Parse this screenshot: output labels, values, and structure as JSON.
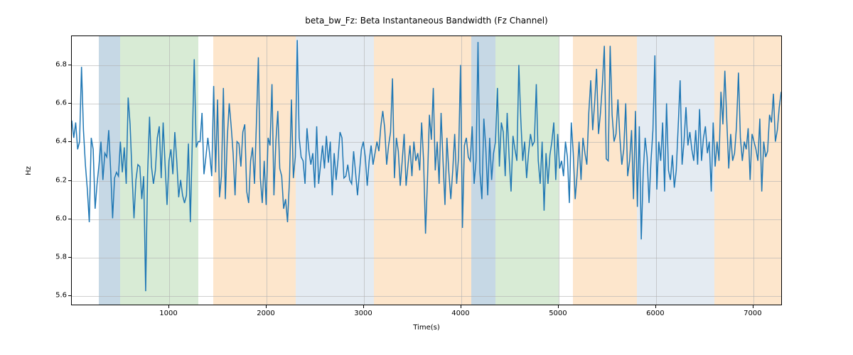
{
  "chart_data": {
    "type": "line",
    "title": "beta_bw_Fz: Beta Instantaneous Bandwidth (Fz Channel)",
    "xlabel": "Time(s)",
    "ylabel": "Hz",
    "xlim": [
      0,
      7300
    ],
    "ylim": [
      5.55,
      6.95
    ],
    "xticks": [
      1000,
      2000,
      3000,
      4000,
      5000,
      6000,
      7000
    ],
    "yticks": [
      5.6,
      5.8,
      6.0,
      6.2,
      6.4,
      6.6,
      6.8
    ],
    "spans": [
      {
        "x0": 280,
        "x1": 500,
        "color": "blue"
      },
      {
        "x0": 500,
        "x1": 1300,
        "color": "green"
      },
      {
        "x0": 1450,
        "x1": 2300,
        "color": "orange"
      },
      {
        "x0": 2300,
        "x1": 3100,
        "color": "lblue"
      },
      {
        "x0": 3100,
        "x1": 3200,
        "color": "orange"
      },
      {
        "x0": 3200,
        "x1": 4100,
        "color": "orange"
      },
      {
        "x0": 4100,
        "x1": 4350,
        "color": "blue"
      },
      {
        "x0": 4350,
        "x1": 5000,
        "color": "green"
      },
      {
        "x0": 5150,
        "x1": 5800,
        "color": "orange"
      },
      {
        "x0": 5800,
        "x1": 6600,
        "color": "lblue"
      },
      {
        "x0": 6600,
        "x1": 7300,
        "color": "orange"
      }
    ],
    "x": [
      0,
      20,
      40,
      60,
      80,
      100,
      120,
      140,
      160,
      180,
      200,
      220,
      240,
      260,
      280,
      300,
      320,
      340,
      360,
      380,
      400,
      420,
      440,
      460,
      480,
      500,
      520,
      540,
      560,
      580,
      600,
      620,
      640,
      660,
      680,
      700,
      720,
      740,
      760,
      780,
      800,
      820,
      840,
      860,
      880,
      900,
      920,
      940,
      960,
      980,
      1000,
      1020,
      1040,
      1060,
      1080,
      1100,
      1120,
      1140,
      1160,
      1180,
      1200,
      1220,
      1240,
      1260,
      1280,
      1300,
      1320,
      1340,
      1360,
      1380,
      1400,
      1420,
      1440,
      1460,
      1480,
      1500,
      1520,
      1540,
      1560,
      1580,
      1600,
      1620,
      1640,
      1660,
      1680,
      1700,
      1720,
      1740,
      1760,
      1780,
      1800,
      1820,
      1840,
      1860,
      1880,
      1900,
      1920,
      1940,
      1960,
      1980,
      2000,
      2020,
      2040,
      2060,
      2080,
      2100,
      2120,
      2140,
      2160,
      2180,
      2200,
      2220,
      2240,
      2260,
      2280,
      2300,
      2320,
      2340,
      2360,
      2380,
      2400,
      2420,
      2440,
      2460,
      2480,
      2500,
      2520,
      2540,
      2560,
      2580,
      2600,
      2620,
      2640,
      2660,
      2680,
      2700,
      2720,
      2740,
      2760,
      2780,
      2800,
      2820,
      2840,
      2860,
      2880,
      2900,
      2920,
      2940,
      2960,
      2980,
      3000,
      3020,
      3040,
      3060,
      3080,
      3100,
      3120,
      3140,
      3160,
      3180,
      3200,
      3220,
      3240,
      3260,
      3280,
      3300,
      3320,
      3340,
      3360,
      3380,
      3400,
      3420,
      3440,
      3460,
      3480,
      3500,
      3520,
      3540,
      3560,
      3580,
      3600,
      3620,
      3640,
      3660,
      3680,
      3700,
      3720,
      3740,
      3760,
      3780,
      3800,
      3820,
      3840,
      3860,
      3880,
      3900,
      3920,
      3940,
      3960,
      3980,
      4000,
      4020,
      4040,
      4060,
      4080,
      4100,
      4120,
      4140,
      4160,
      4180,
      4200,
      4220,
      4240,
      4260,
      4280,
      4300,
      4320,
      4340,
      4360,
      4380,
      4400,
      4420,
      4440,
      4460,
      4480,
      4500,
      4520,
      4540,
      4560,
      4580,
      4600,
      4620,
      4640,
      4660,
      4680,
      4700,
      4720,
      4740,
      4760,
      4780,
      4800,
      4820,
      4840,
      4860,
      4880,
      4900,
      4920,
      4940,
      4960,
      4980,
      5000,
      5020,
      5040,
      5060,
      5080,
      5100,
      5120,
      5140,
      5160,
      5180,
      5200,
      5220,
      5240,
      5260,
      5280,
      5300,
      5320,
      5340,
      5360,
      5380,
      5400,
      5420,
      5440,
      5460,
      5480,
      5500,
      5520,
      5540,
      5560,
      5580,
      5600,
      5620,
      5640,
      5660,
      5680,
      5700,
      5720,
      5740,
      5760,
      5780,
      5800,
      5820,
      5840,
      5860,
      5880,
      5900,
      5920,
      5940,
      5960,
      5980,
      6000,
      6020,
      6040,
      6060,
      6080,
      6100,
      6120,
      6140,
      6160,
      6180,
      6200,
      6220,
      6240,
      6260,
      6280,
      6300,
      6320,
      6340,
      6360,
      6380,
      6400,
      6420,
      6440,
      6460,
      6480,
      6500,
      6520,
      6540,
      6560,
      6580,
      6600,
      6620,
      6640,
      6660,
      6680,
      6700,
      6720,
      6740,
      6760,
      6780,
      6800,
      6820,
      6840,
      6860,
      6880,
      6900,
      6920,
      6940,
      6960,
      6980,
      7000,
      7020,
      7040,
      7060,
      7080,
      7100,
      7120,
      7140,
      7160,
      7180,
      7200,
      7220,
      7240,
      7260,
      7280,
      7300
    ],
    "values": [
      6.51,
      6.42,
      6.5,
      6.36,
      6.4,
      6.79,
      6.46,
      6.28,
      6.15,
      5.98,
      6.42,
      6.36,
      6.05,
      6.18,
      6.28,
      6.4,
      6.2,
      6.34,
      6.32,
      6.46,
      6.25,
      6.0,
      6.21,
      6.24,
      6.22,
      6.4,
      6.24,
      6.37,
      6.18,
      6.63,
      6.49,
      6.23,
      6.0,
      6.2,
      6.28,
      6.27,
      6.1,
      6.22,
      5.62,
      6.23,
      6.53,
      6.27,
      6.18,
      6.25,
      6.42,
      6.48,
      6.21,
      6.5,
      6.28,
      6.07,
      6.3,
      6.36,
      6.23,
      6.45,
      6.3,
      6.11,
      6.2,
      6.12,
      6.08,
      6.12,
      6.39,
      5.98,
      6.4,
      6.83,
      6.37,
      6.4,
      6.4,
      6.55,
      6.23,
      6.32,
      6.42,
      6.33,
      6.22,
      6.69,
      6.24,
      6.62,
      6.11,
      6.22,
      6.68,
      6.1,
      6.42,
      6.6,
      6.48,
      6.34,
      6.12,
      6.4,
      6.39,
      6.27,
      6.45,
      6.49,
      6.14,
      6.08,
      6.3,
      6.37,
      6.18,
      6.5,
      6.84,
      6.21,
      6.08,
      6.3,
      6.07,
      6.42,
      6.38,
      6.7,
      6.12,
      6.4,
      6.56,
      6.26,
      6.22,
      6.05,
      6.1,
      5.98,
      6.2,
      6.62,
      6.21,
      6.32,
      6.93,
      6.42,
      6.32,
      6.3,
      6.18,
      6.47,
      6.35,
      6.28,
      6.34,
      6.16,
      6.48,
      6.18,
      6.28,
      6.38,
      6.26,
      6.43,
      6.29,
      6.4,
      6.12,
      6.34,
      6.2,
      6.31,
      6.45,
      6.42,
      6.21,
      6.22,
      6.28,
      6.2,
      6.18,
      6.35,
      6.24,
      6.12,
      6.24,
      6.36,
      6.4,
      6.32,
      6.17,
      6.3,
      6.38,
      6.28,
      6.34,
      6.4,
      6.35,
      6.48,
      6.56,
      6.47,
      6.28,
      6.38,
      6.45,
      6.73,
      6.21,
      6.42,
      6.35,
      6.17,
      6.3,
      6.44,
      6.17,
      6.28,
      6.38,
      6.22,
      6.4,
      6.3,
      6.34,
      6.25,
      6.5,
      6.3,
      5.92,
      6.2,
      6.54,
      6.41,
      6.68,
      6.25,
      6.4,
      6.18,
      6.55,
      6.3,
      6.07,
      6.42,
      6.24,
      6.1,
      6.25,
      6.44,
      6.18,
      6.32,
      6.8,
      5.95,
      6.38,
      6.42,
      6.32,
      6.3,
      6.48,
      6.18,
      6.3,
      6.92,
      6.24,
      6.1,
      6.52,
      6.37,
      6.12,
      6.42,
      6.2,
      6.34,
      6.4,
      6.68,
      6.27,
      6.5,
      6.45,
      6.22,
      6.55,
      6.32,
      6.14,
      6.43,
      6.36,
      6.3,
      6.8,
      6.52,
      6.3,
      6.4,
      6.21,
      6.34,
      6.44,
      6.38,
      6.4,
      6.7,
      6.3,
      6.18,
      6.4,
      6.04,
      6.34,
      6.18,
      6.33,
      6.4,
      6.5,
      6.2,
      6.44,
      6.26,
      6.3,
      6.22,
      6.4,
      6.32,
      6.08,
      6.5,
      6.34,
      6.1,
      6.23,
      6.4,
      6.2,
      6.42,
      6.34,
      6.28,
      6.55,
      6.72,
      6.46,
      6.6,
      6.78,
      6.44,
      6.55,
      6.7,
      6.9,
      6.31,
      6.3,
      6.9,
      6.54,
      6.4,
      6.44,
      6.62,
      6.42,
      6.28,
      6.36,
      6.6,
      6.22,
      6.3,
      6.46,
      6.1,
      6.56,
      6.06,
      6.48,
      5.89,
      6.24,
      6.42,
      6.32,
      6.08,
      6.3,
      6.46,
      6.85,
      6.15,
      6.4,
      6.3,
      6.5,
      6.14,
      6.6,
      6.25,
      6.2,
      6.33,
      6.16,
      6.25,
      6.48,
      6.72,
      6.28,
      6.4,
      6.58,
      6.38,
      6.45,
      6.36,
      6.3,
      6.46,
      6.28,
      6.57,
      6.3,
      6.42,
      6.48,
      6.34,
      6.4,
      6.14,
      6.5,
      6.27,
      6.4,
      6.3,
      6.66,
      6.49,
      6.77,
      6.51,
      6.26,
      6.44,
      6.3,
      6.34,
      6.48,
      6.76,
      6.42,
      6.3,
      6.4,
      6.36,
      6.47,
      6.2,
      6.44,
      6.4,
      6.36,
      6.3,
      6.52,
      6.14,
      6.4,
      6.32,
      6.35,
      6.54,
      6.5,
      6.65,
      6.4,
      6.46,
      6.58,
      6.66
    ]
  }
}
